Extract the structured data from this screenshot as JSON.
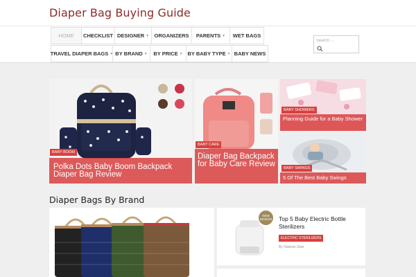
{
  "site": {
    "title": "Diaper Bag Buying Guide"
  },
  "nav": {
    "row1": [
      {
        "label": "Home",
        "caret": false,
        "active": true
      },
      {
        "label": "Checklist",
        "caret": false
      },
      {
        "label": "Designer",
        "caret": true
      },
      {
        "label": "Organizers",
        "caret": false
      },
      {
        "label": "Parents",
        "caret": true
      },
      {
        "label": "Wet Bags",
        "caret": false
      }
    ],
    "row2": [
      {
        "label": "Travel Diaper Bags",
        "caret": true
      },
      {
        "label": "By Brand",
        "caret": true
      },
      {
        "label": "By Price",
        "caret": true
      },
      {
        "label": "By Baby Type",
        "caret": true
      },
      {
        "label": "Baby News",
        "caret": false
      }
    ]
  },
  "search": {
    "placeholder": "Search ..."
  },
  "featured": [
    {
      "category": "Baby Boom",
      "title": "Polka Dots Baby Boom Backpack Diaper Bag Review"
    },
    {
      "category": "Baby Care",
      "title": "Diaper Bag Backpack for Baby Care Review"
    },
    {
      "category": "Baby Showers",
      "title": "Planning Guide for a Baby Shower"
    },
    {
      "category": "Baby Swings",
      "title": "5 Of The Best Baby Swings"
    }
  ],
  "section": {
    "title": "Diaper Bags By Brand"
  },
  "post": {
    "badge": "NEW DESIGN",
    "title": "Top 5 Baby Electric Bottle Sterilizers",
    "category": "ELECTRIC STERILIZERS",
    "author": "By Nadean Starr"
  },
  "colors": {
    "accent": "#d8413d",
    "brand": "#8e2a2a"
  }
}
